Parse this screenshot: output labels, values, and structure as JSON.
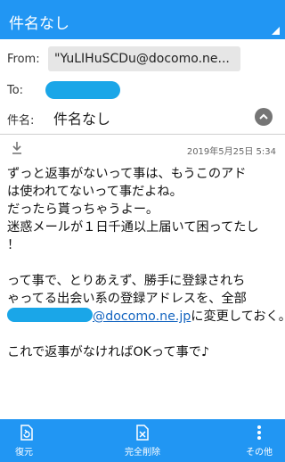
{
  "header": {
    "title": "件名なし"
  },
  "from": {
    "label": "From:",
    "value": "\"YuLIHuSCDu@docomo.ne..."
  },
  "to": {
    "label": "To:"
  },
  "subject": {
    "label": "件名:",
    "value": "件名なし"
  },
  "meta": {
    "date": "2019年5月25日  5:34"
  },
  "body": {
    "lines_p1": [
      "ずっと返事がないって事は、もうこのアド",
      "は使われてないって事だよね。",
      "だったら貰っちゃうよー。",
      "迷惑メールが１日千通以上届いて困ってたし",
      "！"
    ],
    "lines_p2": [
      "って事で、とりあえず、勝手に登録されち",
      "ゃってる出会い系の登録アドレスを、全部"
    ],
    "link_text": "@docomo.ne.jp",
    "after_link": "に変更しておく。",
    "closing": "これで返事がなければOKって事で♪"
  },
  "bottom_bar": {
    "restore": "復元",
    "delete_all": "完全削除",
    "other": "その他"
  },
  "colors": {
    "accent": "#2196f3",
    "redaction": "#1aa6e8"
  }
}
